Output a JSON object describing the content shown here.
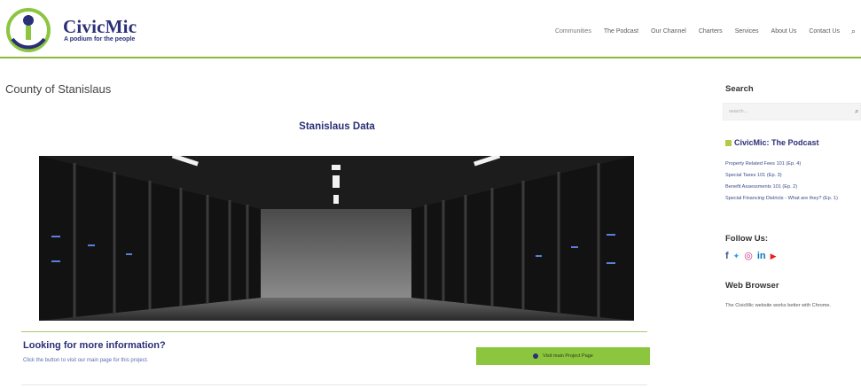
{
  "header": {
    "brand_name": "CivicMic",
    "brand_tagline": "A podium for the people",
    "nav": [
      "Communities",
      "The Podcast",
      "Our Channel",
      "Charters",
      "Services",
      "About Us",
      "Contact Us"
    ],
    "search_icon": "search-icon"
  },
  "main": {
    "page_title": "County of Stanislaus",
    "section_heading": "Stanislaus Data",
    "image_subject": "server-room",
    "more_info_title": "Looking for more information?",
    "more_info_text": "Click the button to visit our main page for this project.",
    "cta_label": "Visit main Project Page"
  },
  "sidebar": {
    "search_heading": "Search",
    "search_placeholder": "search...",
    "podcast_heading": "CivicMic: The Podcast",
    "podcast_links": [
      "Property Related Fees 101 (Ep. 4)",
      "Special Taxes 101 (Ep. 3)",
      "Benefit Assessments 101 (Ep. 2)",
      "Special Financing Districts - What are they? (Ep. 1)"
    ],
    "follow_heading": "Follow Us:",
    "social": [
      {
        "icon": "facebook-icon",
        "glyph": "f",
        "color": "#3b5998"
      },
      {
        "icon": "twitter-icon",
        "glyph": "🐦",
        "color": "#1da1f2"
      },
      {
        "icon": "instagram-icon",
        "glyph": "◎",
        "color": "#c13584"
      },
      {
        "icon": "linkedin-icon",
        "glyph": "in",
        "color": "#0077b5"
      },
      {
        "icon": "youtube-icon",
        "glyph": "▶",
        "color": "#e62117"
      }
    ],
    "browser_heading": "Web Browser",
    "browser_text": "The CivicMic website works better with Chrome."
  },
  "colors": {
    "brand_navy": "#2b2f77",
    "accent_green": "#8cc63f",
    "divider_green": "#8cb93c"
  }
}
